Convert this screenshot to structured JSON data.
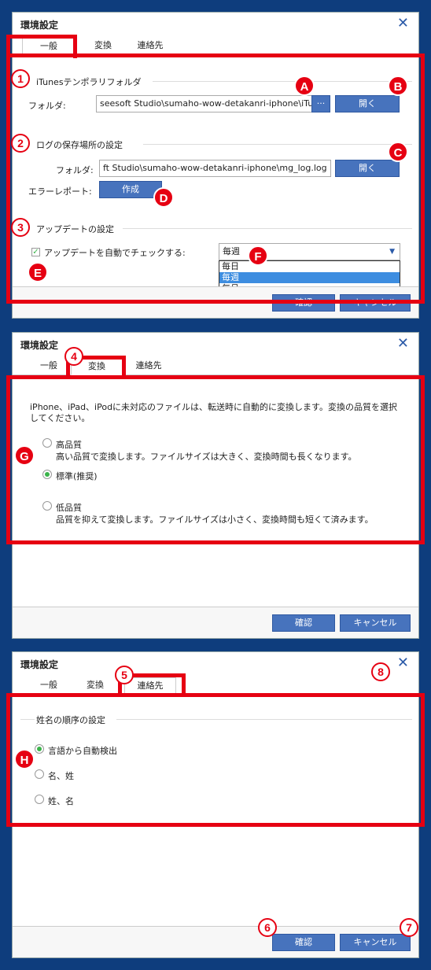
{
  "dialog_title": "環境設定",
  "tabs": [
    "一般",
    "変換",
    "連絡先"
  ],
  "footer": {
    "ok_label": "確認",
    "cancel_label": "キャンセル"
  },
  "general": {
    "itunes_section": "iTunesテンポラリフォルダ",
    "folder_label": "フォルダ:",
    "itunes_path": "seesoft Studio\\sumaho-wow-detakanri-iphone\\iTunes",
    "browse_label": "···",
    "open_label": "開く",
    "log_section": "ログの保存場所の設定",
    "log_path": "ft Studio\\sumaho-wow-detakanri-iphone\\mg_log.log",
    "error_report_label": "エラーレポート:",
    "create_label": "作成",
    "update_section": "アップデートの設定",
    "auto_check_label": "アップデートを自動でチェックする:",
    "freq_selected": "毎週",
    "freq_options": [
      "毎日",
      "毎週",
      "毎月"
    ]
  },
  "convert": {
    "description": "iPhone、iPad、iPodに未対応のファイルは、転送時に自動的に変換します。変換の品質を選択してください。",
    "high_label": "高品質",
    "high_desc": "高い品質で変換します。ファイルサイズは大きく、変換時間も長くなります。",
    "standard_label": "標準(推奨)",
    "low_label": "低品質",
    "low_desc": "品質を抑えて変換します。ファイルサイズは小さく、変換時間も短くて済みます。"
  },
  "contacts": {
    "section": "姓名の順序の設定",
    "options": [
      "言語から自動検出",
      "名、姓",
      "姓、名"
    ]
  },
  "markers": [
    "A",
    "B",
    "C",
    "D",
    "E",
    "F",
    "G",
    "H"
  ],
  "numbers": [
    "1",
    "2",
    "3",
    "4",
    "5",
    "6",
    "7",
    "8"
  ],
  "colors": {
    "accent": "#e60012",
    "button": "#4773bd",
    "background": "#0e3d7d"
  }
}
